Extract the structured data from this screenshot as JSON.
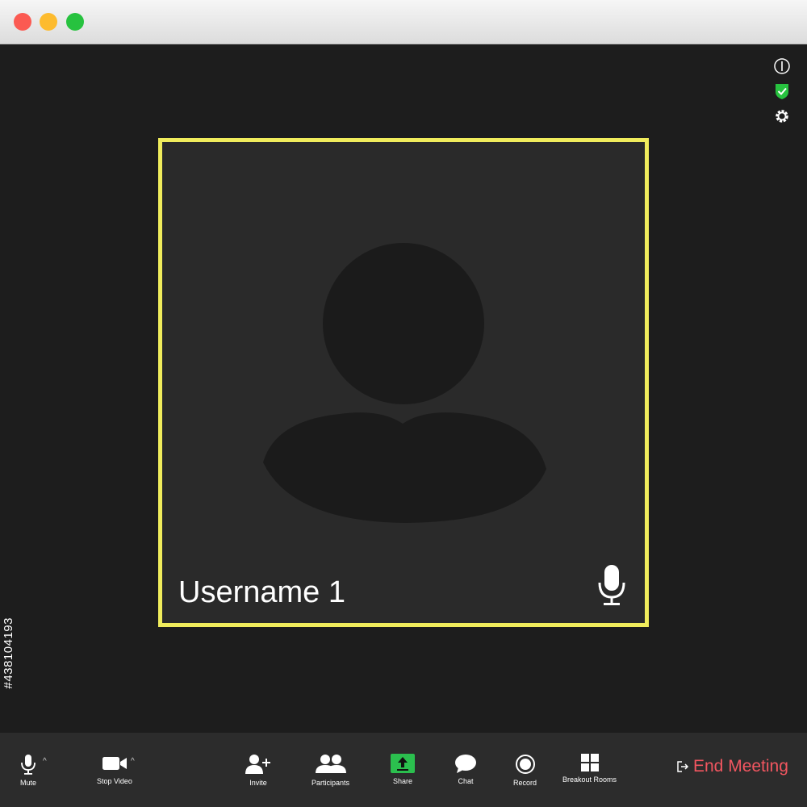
{
  "window": {
    "controls": [
      "close",
      "minimize",
      "maximize"
    ]
  },
  "tile": {
    "username": "Username 1",
    "border_color": "#f0ec5c",
    "mic_icon": "microphone-icon"
  },
  "top_icons": [
    "info-icon",
    "shield-check-icon",
    "gear-icon"
  ],
  "toolbar": {
    "mute": "Mute",
    "stop_video": "Stop Video",
    "invite": "Invite",
    "participants": "Participants",
    "share": "Share",
    "chat": "Chat",
    "record": "Record",
    "breakout_rooms": "Breakout Rooms",
    "end_meeting": "End Meeting"
  },
  "side_id": "#438104193",
  "colors": {
    "end_meeting": "#f25660",
    "share": "#2bbf4e",
    "shield": "#27c23f"
  }
}
